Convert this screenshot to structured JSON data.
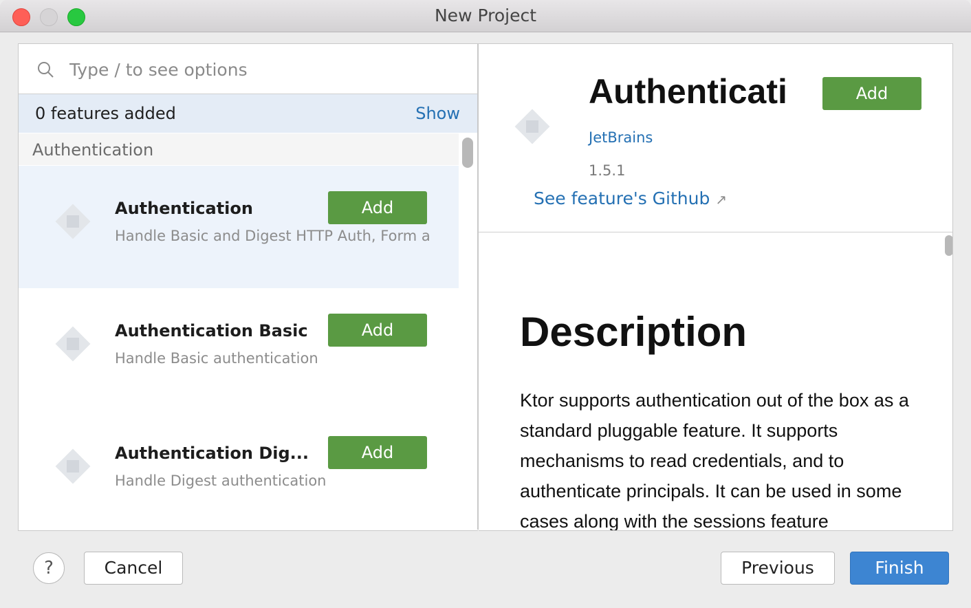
{
  "window": {
    "title": "New Project"
  },
  "search": {
    "placeholder": "Type / to see options",
    "value": ""
  },
  "features_bar": {
    "count_text": "0 features added",
    "show_label": "Show"
  },
  "group": {
    "label": "Authentication"
  },
  "features": [
    {
      "name": "Authentication",
      "description": "Handle Basic and Digest HTTP Auth, Form a",
      "add_label": "Add",
      "selected": true
    },
    {
      "name": "Authentication Basic",
      "description": "Handle Basic authentication",
      "add_label": "Add",
      "selected": false
    },
    {
      "name": "Authentication Dig...",
      "description": "Handle Digest authentication",
      "add_label": "Add",
      "selected": false
    }
  ],
  "detail": {
    "title": "Authenticati",
    "add_label": "Add",
    "vendor": "JetBrains",
    "version": "1.5.1",
    "github_link": "See feature's Github",
    "github_arrow": "↗",
    "description_heading": "Description",
    "description_text": "Ktor supports authentication out of the box as a standard pluggable feature. It supports mechanisms to read credentials, and to authenticate principals. It can be used in some cases along with the sessions feature"
  },
  "footer": {
    "help_label": "?",
    "cancel_label": "Cancel",
    "previous_label": "Previous",
    "finish_label": "Finish"
  },
  "colors": {
    "accent_green": "#5a9a43",
    "link_blue": "#2470b3",
    "primary_button": "#3d85d2",
    "selected_row": "#edf3fb"
  },
  "icons": {
    "search": "search-icon",
    "feature": "feature-placeholder-icon",
    "external": "external-link-icon",
    "help": "help-icon"
  }
}
